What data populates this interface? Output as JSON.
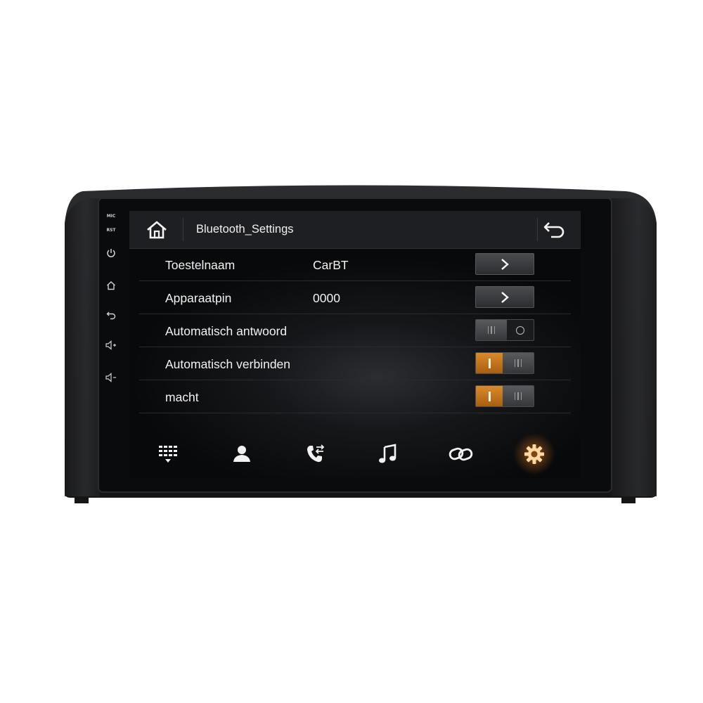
{
  "device": {
    "side_labels": {
      "mic": "MIC",
      "rst": "RST"
    }
  },
  "header": {
    "title": "Bluetooth_Settings"
  },
  "settings": [
    {
      "label": "Toestelnaam",
      "value": "CarBT",
      "control": "arrow"
    },
    {
      "label": "Apparaatpin",
      "value": "0000",
      "control": "arrow"
    },
    {
      "label": "Automatisch antwoord",
      "value": "",
      "control": "toggle",
      "state": "off"
    },
    {
      "label": "Automatisch verbinden",
      "value": "",
      "control": "toggle",
      "state": "on"
    },
    {
      "label": "macht",
      "value": "",
      "control": "toggle",
      "state": "on"
    }
  ],
  "bottom_nav": [
    {
      "icon": "dialpad-icon",
      "active": false
    },
    {
      "icon": "contacts-icon",
      "active": false
    },
    {
      "icon": "call-log-icon",
      "active": false
    },
    {
      "icon": "music-icon",
      "active": false
    },
    {
      "icon": "link-icon",
      "active": false
    },
    {
      "icon": "gear-icon",
      "active": true
    }
  ],
  "colors": {
    "accent": "#d98a2a",
    "screen_bg": "#0c0d0f",
    "topbar_bg": "#1e1f22",
    "text": "#f2f2f2"
  }
}
